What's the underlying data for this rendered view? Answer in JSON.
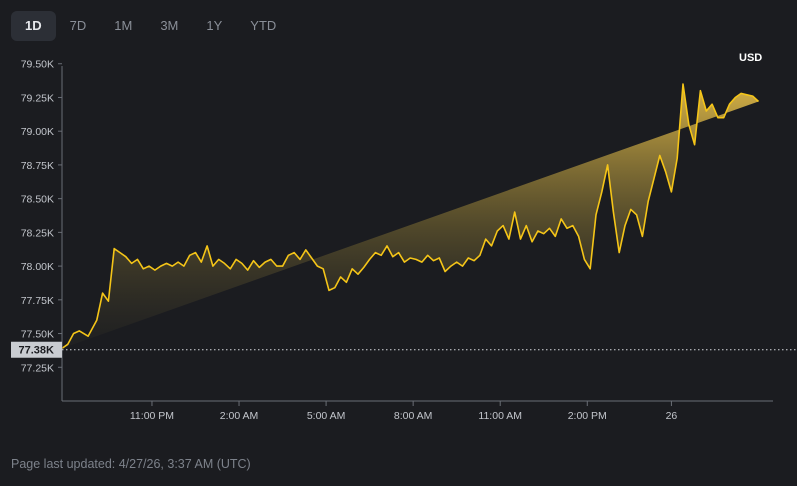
{
  "tabs": [
    {
      "label": "1D",
      "active": true
    },
    {
      "label": "7D",
      "active": false
    },
    {
      "label": "1M",
      "active": false
    },
    {
      "label": "3M",
      "active": false
    },
    {
      "label": "1Y",
      "active": false
    },
    {
      "label": "YTD",
      "active": false
    }
  ],
  "currency": "USD",
  "footer": "Page last updated: 4/27/26, 3:37 AM (UTC)",
  "colors": {
    "background": "#1b1c20",
    "line": "#f5c518",
    "current_price_badge": "#c9ccd1",
    "axis": "#6a6e76",
    "tick_text": "#c3c6cc"
  },
  "chart_data": {
    "type": "area",
    "y_unit": "K",
    "ylim": [
      77.0,
      79.55
    ],
    "y_ticks": [
      77.25,
      77.5,
      77.75,
      78.0,
      78.25,
      78.5,
      78.75,
      79.0,
      79.25,
      79.5
    ],
    "y_tick_labels": [
      "77.25K",
      "77.50K",
      "77.75K",
      "78.00K",
      "78.25K",
      "78.50K",
      "78.75K",
      "79.00K",
      "79.25K",
      "79.50K"
    ],
    "x_ticks": [
      3.1,
      6.1,
      9.1,
      12.1,
      15.1,
      18.1,
      21.0
    ],
    "x_tick_labels": [
      "11:00 PM",
      "2:00 AM",
      "5:00 AM",
      "8:00 AM",
      "11:00 AM",
      "2:00 PM",
      "26"
    ],
    "xlim": [
      0,
      24.5
    ],
    "current_price": 77.38,
    "current_price_label": "77.38K",
    "grid": false,
    "x": [
      0,
      0.2,
      0.4,
      0.6,
      0.9,
      1.2,
      1.4,
      1.6,
      1.8,
      2.0,
      2.2,
      2.4,
      2.6,
      2.8,
      3.0,
      3.2,
      3.4,
      3.6,
      3.8,
      4.0,
      4.2,
      4.4,
      4.6,
      4.8,
      5.0,
      5.2,
      5.4,
      5.6,
      5.8,
      6.0,
      6.2,
      6.4,
      6.6,
      6.8,
      7.0,
      7.2,
      7.4,
      7.6,
      7.8,
      8.0,
      8.2,
      8.4,
      8.6,
      8.8,
      9.0,
      9.2,
      9.4,
      9.6,
      9.8,
      10.0,
      10.2,
      10.4,
      10.6,
      10.8,
      11.0,
      11.2,
      11.4,
      11.6,
      11.8,
      12.0,
      12.2,
      12.4,
      12.6,
      12.8,
      13.0,
      13.2,
      13.4,
      13.6,
      13.8,
      14.0,
      14.2,
      14.4,
      14.6,
      14.8,
      15.0,
      15.2,
      15.4,
      15.6,
      15.8,
      16.0,
      16.2,
      16.4,
      16.6,
      16.8,
      17.0,
      17.2,
      17.4,
      17.6,
      17.8,
      18.0,
      18.2,
      18.4,
      18.6,
      18.8,
      19.0,
      19.2,
      19.4,
      19.6,
      19.8,
      20.0,
      20.2,
      20.4,
      20.6,
      20.8,
      21.0,
      21.2,
      21.4,
      21.6,
      21.8,
      22.0,
      22.2,
      22.4,
      22.6,
      22.8,
      23.0,
      23.2,
      23.4,
      23.6,
      23.8,
      24.0,
      24.2,
      24.35
    ],
    "y": [
      77.39,
      77.42,
      77.5,
      77.52,
      77.48,
      77.6,
      77.8,
      77.74,
      78.13,
      78.1,
      78.07,
      78.02,
      78.05,
      77.98,
      78.0,
      77.97,
      78.0,
      78.02,
      78.0,
      78.03,
      78.0,
      78.08,
      78.1,
      78.03,
      78.15,
      78.0,
      78.05,
      78.02,
      77.98,
      78.05,
      78.02,
      77.97,
      78.04,
      77.99,
      78.03,
      78.05,
      78.0,
      78.0,
      78.08,
      78.1,
      78.05,
      78.12,
      78.06,
      78.0,
      77.98,
      77.82,
      77.84,
      77.92,
      77.88,
      77.98,
      77.94,
      77.99,
      78.05,
      78.1,
      78.08,
      78.15,
      78.07,
      78.1,
      78.03,
      78.06,
      78.05,
      78.03,
      78.08,
      78.04,
      78.06,
      77.96,
      78.0,
      78.03,
      78.0,
      78.06,
      78.04,
      78.08,
      78.2,
      78.15,
      78.26,
      78.3,
      78.2,
      78.4,
      78.2,
      78.3,
      78.18,
      78.26,
      78.24,
      78.28,
      78.22,
      78.35,
      78.28,
      78.3,
      78.22,
      78.05,
      77.98,
      78.38,
      78.55,
      78.75,
      78.4,
      78.1,
      78.3,
      78.42,
      78.38,
      78.22,
      78.48,
      78.65,
      78.82,
      78.7,
      78.55,
      78.8,
      79.35,
      79.05,
      78.9,
      79.3,
      79.15,
      79.2,
      79.1,
      79.1,
      79.2,
      79.25,
      79.28,
      79.27,
      79.26,
      79.22
    ]
  }
}
